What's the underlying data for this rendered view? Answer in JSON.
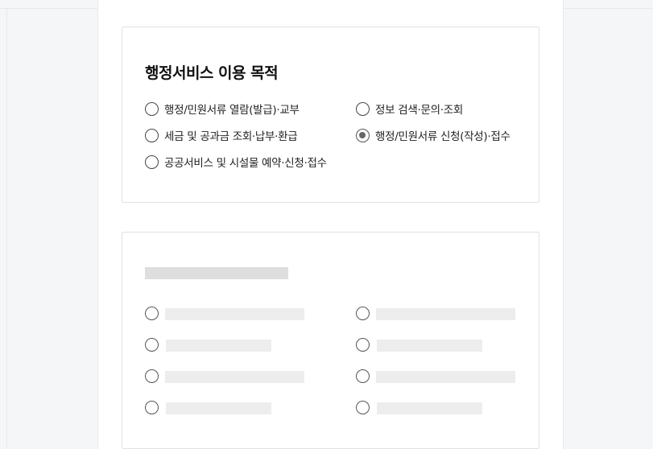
{
  "section": {
    "title": "행정서비스 이용 목적",
    "options": [
      {
        "label": "행정/민원서류 열람(발급)·교부",
        "checked": false
      },
      {
        "label": "정보 검색·문의·조회",
        "checked": false
      },
      {
        "label": "세금 및 공과금 조회·납부·환급",
        "checked": false
      },
      {
        "label": "행정/민원서류 신청(작성)·접수",
        "checked": true
      },
      {
        "label": "공공서비스 및 시설물 예약·신청·접수",
        "checked": false
      }
    ]
  },
  "loading_section": {
    "state": "loading-placeholder",
    "placeholder_option_count": 8
  },
  "colors": {
    "background": "#f5f6f8",
    "card_border": "#e1e1e1",
    "skeleton_title": "#dedede",
    "skeleton_bar": "#ededed",
    "radio_checked_dot": "#666666"
  }
}
